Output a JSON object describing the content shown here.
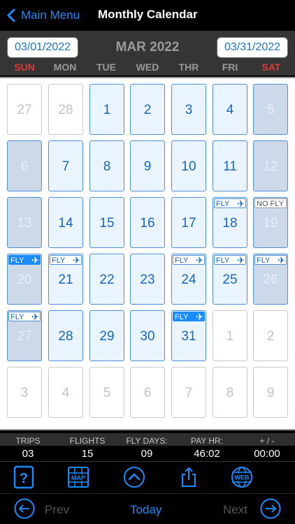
{
  "nav": {
    "back_label": "Main Menu",
    "title": "Monthly Calendar"
  },
  "header": {
    "start_date": "03/01/2022",
    "end_date": "03/31/2022",
    "month_title": "MAR 2022",
    "days_of_week": [
      "SUN",
      "MON",
      "TUE",
      "WED",
      "THR",
      "FRI",
      "SAT"
    ]
  },
  "calendar": {
    "weeks": [
      [
        {
          "d": "27",
          "t": "other"
        },
        {
          "d": "28",
          "t": "other"
        },
        {
          "d": "1",
          "t": "curr"
        },
        {
          "d": "2",
          "t": "curr"
        },
        {
          "d": "3",
          "t": "curr"
        },
        {
          "d": "4",
          "t": "curr"
        },
        {
          "d": "5",
          "t": "weekend"
        }
      ],
      [
        {
          "d": "6",
          "t": "weekend"
        },
        {
          "d": "7",
          "t": "curr"
        },
        {
          "d": "8",
          "t": "curr"
        },
        {
          "d": "9",
          "t": "curr"
        },
        {
          "d": "10",
          "t": "curr"
        },
        {
          "d": "11",
          "t": "curr"
        },
        {
          "d": "12",
          "t": "weekend"
        }
      ],
      [
        {
          "d": "13",
          "t": "weekend"
        },
        {
          "d": "14",
          "t": "curr"
        },
        {
          "d": "15",
          "t": "curr"
        },
        {
          "d": "16",
          "t": "curr"
        },
        {
          "d": "17",
          "t": "curr"
        },
        {
          "d": "18",
          "t": "curr",
          "badge": "FLY"
        },
        {
          "d": "19",
          "t": "weekend",
          "badge": "NO FLY"
        }
      ],
      [
        {
          "d": "20",
          "t": "weekend",
          "badge": "FLY",
          "solid": true
        },
        {
          "d": "21",
          "t": "curr",
          "badge": "FLY"
        },
        {
          "d": "22",
          "t": "curr"
        },
        {
          "d": "23",
          "t": "curr"
        },
        {
          "d": "24",
          "t": "curr",
          "badge": "FLY"
        },
        {
          "d": "25",
          "t": "curr",
          "badge": "FLY"
        },
        {
          "d": "26",
          "t": "weekend",
          "badge": "FLY"
        }
      ],
      [
        {
          "d": "27",
          "t": "weekend",
          "badge": "FLY"
        },
        {
          "d": "28",
          "t": "curr"
        },
        {
          "d": "29",
          "t": "curr"
        },
        {
          "d": "30",
          "t": "curr"
        },
        {
          "d": "31",
          "t": "curr",
          "badge": "FLY",
          "solid": true
        },
        {
          "d": "1",
          "t": "other"
        },
        {
          "d": "2",
          "t": "other"
        }
      ],
      [
        {
          "d": "3",
          "t": "other"
        },
        {
          "d": "4",
          "t": "other"
        },
        {
          "d": "5",
          "t": "other"
        },
        {
          "d": "6",
          "t": "other"
        },
        {
          "d": "7",
          "t": "other"
        },
        {
          "d": "8",
          "t": "other"
        },
        {
          "d": "9",
          "t": "other"
        }
      ]
    ]
  },
  "stats": [
    {
      "label": "TRIPS",
      "value": "03"
    },
    {
      "label": "FLIGHTS",
      "value": "15"
    },
    {
      "label": "FLY DAYS:",
      "value": "09"
    },
    {
      "label": "PAY HR:",
      "value": "46:02"
    },
    {
      "label": "+ / -",
      "value": "00:00"
    }
  ],
  "toolbar": {
    "icons": [
      "help-icon",
      "map-icon",
      "chevron-up-icon",
      "share-icon",
      "web-icon"
    ],
    "map_label": "MAP",
    "web_label": "WEB"
  },
  "bottom_nav": {
    "prev_label": "Prev",
    "today_label": "Today",
    "next_label": "Next"
  },
  "colors": {
    "accent": "#1a8cff",
    "weekend_red": "#e03a3a",
    "header_bg": "#353535"
  }
}
